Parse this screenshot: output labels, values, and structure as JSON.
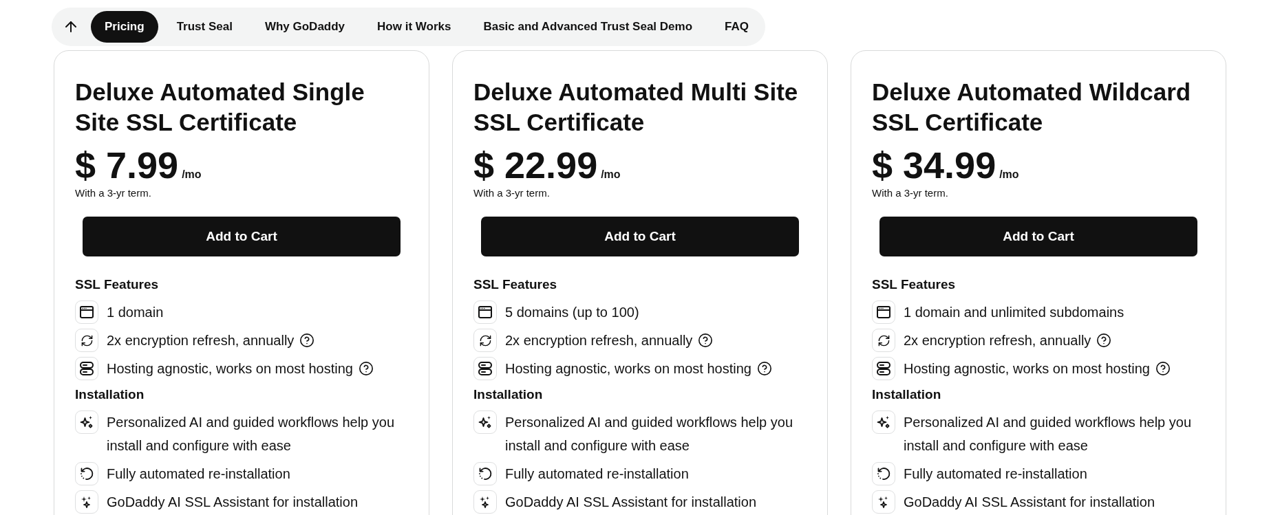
{
  "nav": {
    "tabs": [
      {
        "label": "Pricing",
        "selected": true
      },
      {
        "label": "Trust Seal",
        "selected": false
      },
      {
        "label": "Why GoDaddy",
        "selected": false
      },
      {
        "label": "How it Works",
        "selected": false
      },
      {
        "label": "Basic and Advanced Trust Seal Demo",
        "selected": false
      },
      {
        "label": "FAQ",
        "selected": false
      }
    ]
  },
  "plans": [
    {
      "title": "Deluxe Automated Single Site SSL Certificate",
      "price": "$ 7.99",
      "period": "/mo",
      "term": "With a 3-yr term.",
      "button": "Add to Cart",
      "sections": [
        {
          "heading": "SSL Features",
          "features": [
            {
              "kind": "domain",
              "text": "1 domain",
              "help": false
            },
            {
              "kind": "refresh",
              "text": "2x encryption refresh, annually",
              "help": true
            },
            {
              "kind": "hosting",
              "text": "Hosting agnostic, works on most hosting",
              "help": true
            }
          ]
        },
        {
          "heading": "Installation",
          "features": [
            {
              "kind": "ai",
              "text": "Personalized AI and guided workflows help you install and configure with ease",
              "help": false
            },
            {
              "kind": "reinstall",
              "text": "Fully automated re-installation",
              "help": false
            },
            {
              "kind": "assistant",
              "text": "GoDaddy AI SSL Assistant for installation",
              "help": false
            }
          ]
        }
      ]
    },
    {
      "title": "Deluxe Automated Multi Site SSL Certificate",
      "price": "$ 22.99",
      "period": "/mo",
      "term": "With a 3-yr term.",
      "button": "Add to Cart",
      "sections": [
        {
          "heading": "SSL Features",
          "features": [
            {
              "kind": "domain",
              "text": "5 domains (up to 100)",
              "help": false
            },
            {
              "kind": "refresh",
              "text": "2x encryption refresh, annually",
              "help": true
            },
            {
              "kind": "hosting",
              "text": "Hosting agnostic, works on most hosting",
              "help": true
            }
          ]
        },
        {
          "heading": "Installation",
          "features": [
            {
              "kind": "ai",
              "text": "Personalized AI and guided workflows help you install and configure with ease",
              "help": false
            },
            {
              "kind": "reinstall",
              "text": "Fully automated re-installation",
              "help": false
            },
            {
              "kind": "assistant",
              "text": "GoDaddy AI SSL Assistant for installation",
              "help": false
            }
          ]
        }
      ]
    },
    {
      "title": "Deluxe Automated Wildcard SSL Certificate",
      "price": "$ 34.99",
      "period": "/mo",
      "term": "With a 3-yr term.",
      "button": "Add to Cart",
      "sections": [
        {
          "heading": "SSL Features",
          "features": [
            {
              "kind": "domain",
              "text": "1 domain and unlimited subdomains",
              "help": false
            },
            {
              "kind": "refresh",
              "text": "2x encryption refresh, annually",
              "help": true
            },
            {
              "kind": "hosting",
              "text": "Hosting agnostic, works on most hosting",
              "help": true
            }
          ]
        },
        {
          "heading": "Installation",
          "features": [
            {
              "kind": "ai",
              "text": "Personalized AI and guided workflows help you install and configure with ease",
              "help": false
            },
            {
              "kind": "reinstall",
              "text": "Fully automated re-installation",
              "help": false
            },
            {
              "kind": "assistant",
              "text": "GoDaddy AI SSL Assistant for installation",
              "help": false
            }
          ]
        }
      ]
    }
  ]
}
